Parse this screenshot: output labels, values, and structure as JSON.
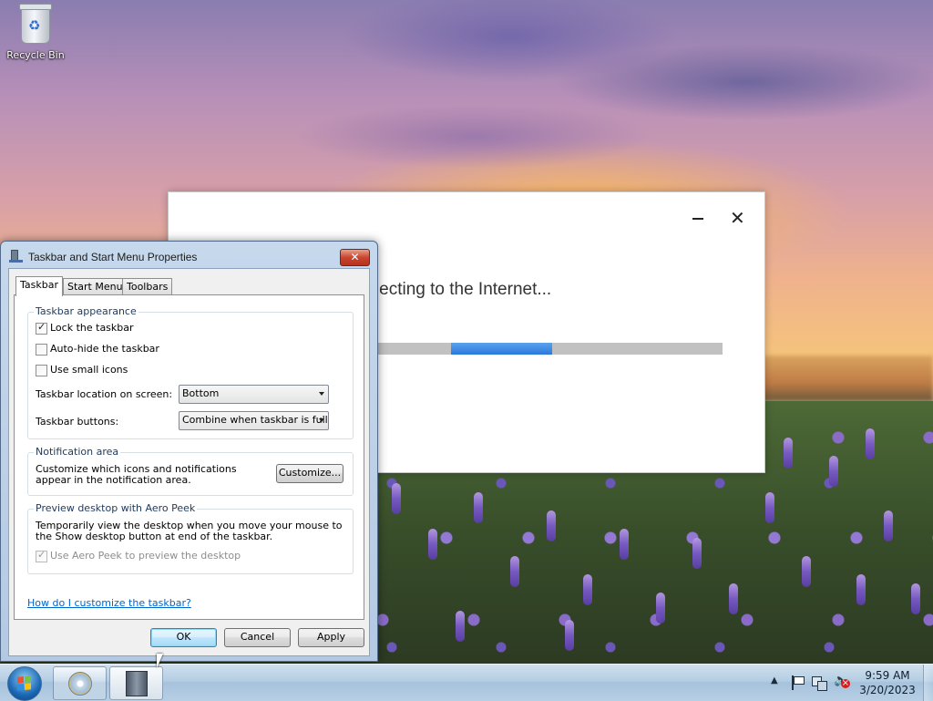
{
  "desktop": {
    "recycle_bin_label": "Recycle Bin"
  },
  "connect_window": {
    "minimize_glyph": "—",
    "close_glyph": "✕",
    "message": "nnecting to the Internet...",
    "progress_fraction": 0.29
  },
  "dialog": {
    "title": "Taskbar and Start Menu Properties",
    "close_glyph": "✕",
    "tabs": [
      "Taskbar",
      "Start Menu",
      "Toolbars"
    ],
    "appearance": {
      "title": "Taskbar appearance",
      "lock_taskbar": {
        "label": "Lock the taskbar",
        "checked": true
      },
      "auto_hide": {
        "label": "Auto-hide the taskbar",
        "checked": false
      },
      "small_icons": {
        "label": "Use small icons",
        "checked": false
      },
      "location_label": "Taskbar location on screen:",
      "location_value": "Bottom",
      "buttons_label": "Taskbar buttons:",
      "buttons_value": "Combine when taskbar is full"
    },
    "notification": {
      "title": "Notification area",
      "description": "Customize which icons and notifications appear in the notification area.",
      "customize_button": "Customize..."
    },
    "aero_peek": {
      "title": "Preview desktop with Aero Peek",
      "description": "Temporarily view the desktop when you move your mouse to the Show desktop button at end of the taskbar.",
      "checkbox": {
        "label": "Use Aero Peek to preview the desktop",
        "checked": true,
        "disabled": true
      }
    },
    "help_link": "How do I customize the taskbar?",
    "buttons": {
      "ok": "OK",
      "cancel": "Cancel",
      "apply": "Apply"
    }
  },
  "taskbar": {
    "tray_arrow": "▲",
    "clock_time": "9:59 AM",
    "clock_date": "3/20/2023"
  },
  "colors": {
    "accent": "#3c7fb1",
    "progress": "#2b79da",
    "link": "#0066cc",
    "close_red": "#c9452e"
  }
}
